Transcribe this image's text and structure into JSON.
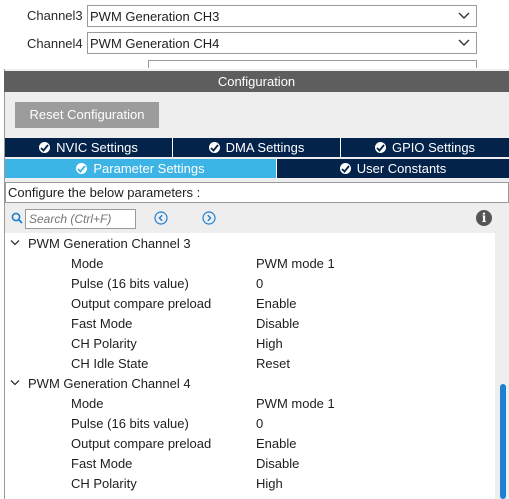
{
  "channels": [
    {
      "label": "Channel3",
      "value": "PWM Generation CH3"
    },
    {
      "label": "Channel4",
      "value": "PWM Generation CH4"
    }
  ],
  "config": {
    "header": "Configuration",
    "reset_label": "Reset Configuration"
  },
  "tabs": {
    "row1": [
      {
        "label": "NVIC Settings"
      },
      {
        "label": "DMA Settings"
      },
      {
        "label": "GPIO Settings"
      }
    ],
    "row2": [
      {
        "label": "Parameter Settings",
        "active": true
      },
      {
        "label": "User Constants",
        "active": false
      }
    ]
  },
  "configure_text": "Configure the below parameters :",
  "search": {
    "placeholder": "Search (Ctrl+F)"
  },
  "groups": [
    {
      "title": "PWM Generation Channel 3",
      "params": [
        {
          "name": "Mode",
          "value": "PWM mode 1"
        },
        {
          "name": "Pulse (16 bits value)",
          "value": "0"
        },
        {
          "name": "Output compare preload",
          "value": "Enable"
        },
        {
          "name": "Fast Mode",
          "value": "Disable"
        },
        {
          "name": "CH Polarity",
          "value": "High"
        },
        {
          "name": "CH Idle State",
          "value": "Reset"
        }
      ]
    },
    {
      "title": "PWM Generation Channel 4",
      "params": [
        {
          "name": "Mode",
          "value": "PWM mode 1"
        },
        {
          "name": "Pulse (16 bits value)",
          "value": "0"
        },
        {
          "name": "Output compare preload",
          "value": "Enable"
        },
        {
          "name": "Fast Mode",
          "value": "Disable"
        },
        {
          "name": "CH Polarity",
          "value": "High"
        }
      ]
    }
  ],
  "colors": {
    "tab_dark": "#03234b",
    "tab_active": "#3cb4e6",
    "header_bg": "#5e5e5e",
    "scroll_thumb": "#1f7fd1"
  }
}
